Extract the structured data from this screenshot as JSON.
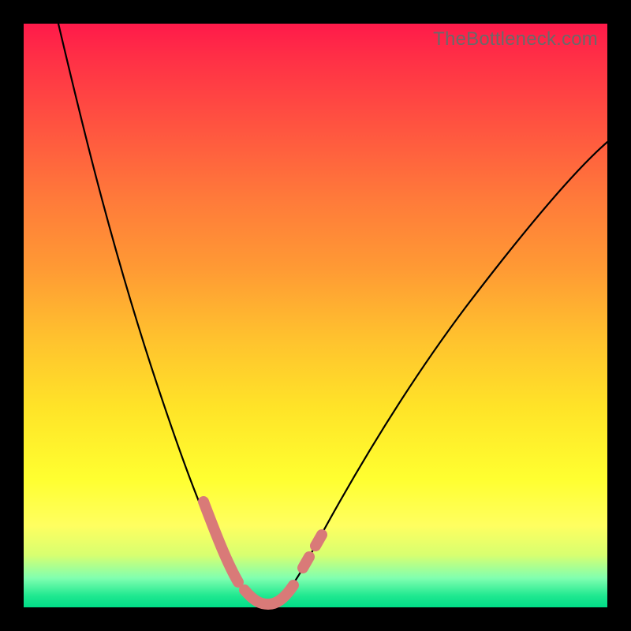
{
  "watermark": "TheBottleneck.com",
  "colors": {
    "background": "#000000",
    "marker": "#d97a78",
    "curve": "#000000"
  },
  "chart_data": {
    "type": "line",
    "title": "",
    "xlabel": "",
    "ylabel": "",
    "xlim": [
      0,
      100
    ],
    "ylim": [
      0,
      100
    ],
    "grid": false,
    "legend": false,
    "series": [
      {
        "name": "bottleneck-curve",
        "x": [
          6,
          10,
          14,
          18,
          22,
          26,
          30,
          34,
          36,
          38,
          40,
          42,
          44,
          48,
          54,
          60,
          68,
          76,
          84,
          92,
          100
        ],
        "y": [
          100,
          85,
          72,
          60,
          48,
          36,
          24,
          12,
          7,
          3,
          1,
          1,
          3,
          8,
          18,
          28,
          40,
          50,
          58,
          64,
          69
        ]
      }
    ],
    "markers": [
      {
        "name": "left-descent-segment",
        "x_range": [
          30,
          37
        ],
        "style": "thick"
      },
      {
        "name": "valley-floor-segment",
        "x_range": [
          37,
          44
        ],
        "style": "thick"
      },
      {
        "name": "right-ascent-dot-1",
        "x": 46,
        "style": "dot"
      },
      {
        "name": "right-ascent-dot-2",
        "x": 48,
        "style": "dot"
      }
    ]
  }
}
